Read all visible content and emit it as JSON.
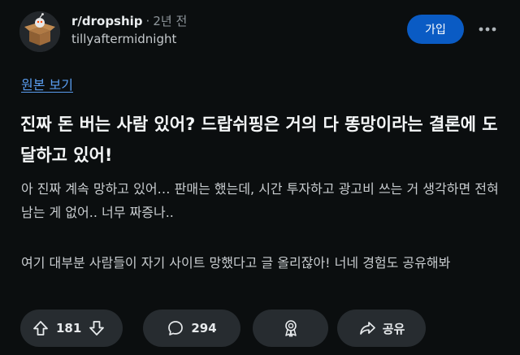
{
  "post": {
    "subreddit": "r/dropship",
    "separator": "·",
    "time_ago": "2년 전",
    "author": "tillyaftermidnight",
    "join_label": "가입",
    "view_original": "원본 보기",
    "title": "진짜 돈 버는 사람 있어? 드랍쉬핑은 거의 다 똥망이라는 결론에 도달하고 있어!",
    "body": [
      "아 진짜 계속 망하고 있어… 판매는 했는데, 시간 투자하고 광고비 쓰는 거 생각하면 전혀 남는 게 없어.. 너무 짜증나..",
      "여기 대부분 사람들이 자기 사이트 망했다고 글 올리잖아! 너네 경험도 공유해봐"
    ]
  },
  "actions": {
    "votes": "181",
    "comments": "294",
    "share_label": "공유"
  },
  "icons": {
    "avatar": "snoo-box-avatar-icon",
    "more": "more-horizontal-icon",
    "upvote": "arrow-up-icon",
    "downvote": "arrow-down-icon",
    "comment": "comment-bubble-icon",
    "award": "award-icon",
    "share": "share-arrow-icon"
  },
  "colors": {
    "background": "#0b0e0f",
    "join_button": "#0a5bc4",
    "link": "#5a9df0",
    "pill": "#272c30"
  }
}
